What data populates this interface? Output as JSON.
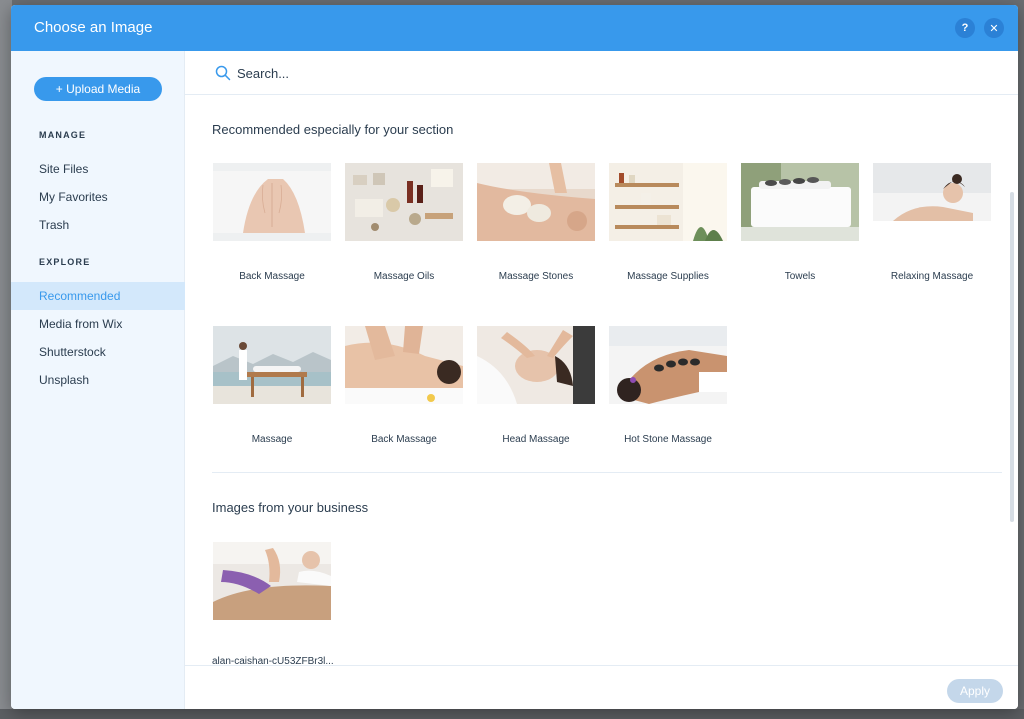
{
  "modal": {
    "title": "Choose an Image",
    "help_label": "?",
    "close_label": "✕"
  },
  "sidebar": {
    "upload_label": "+ Upload Media",
    "manage_label": "MANAGE",
    "manage_items": [
      "Site Files",
      "My Favorites",
      "Trash"
    ],
    "explore_label": "EXPLORE",
    "explore_items": [
      "Recommended",
      "Media from Wix",
      "Shutterstock",
      "Unsplash"
    ],
    "active_item": "Recommended"
  },
  "search": {
    "placeholder": "Search..."
  },
  "recommended": {
    "title": "Recommended especially for your section",
    "items": [
      {
        "caption": "Back Massage",
        "icon": "back-massage-photo"
      },
      {
        "caption": "Massage Oils",
        "icon": "massage-oils-photo"
      },
      {
        "caption": "Massage Stones",
        "icon": "massage-stones-photo"
      },
      {
        "caption": "Massage Supplies",
        "icon": "massage-supplies-photo"
      },
      {
        "caption": "Towels",
        "icon": "towels-photo"
      },
      {
        "caption": "Relaxing Massage",
        "icon": "relaxing-massage-photo"
      },
      {
        "caption": "Massage",
        "icon": "massage-photo"
      },
      {
        "caption": "Back Massage",
        "icon": "back-massage-photo"
      },
      {
        "caption": "Head Massage",
        "icon": "head-massage-photo"
      },
      {
        "caption": "Hot Stone Massage",
        "icon": "hot-stone-massage-photo"
      }
    ]
  },
  "business": {
    "title": "Images from your business",
    "items": [
      {
        "caption": "alan-caishan-cU53ZFBr3l...",
        "icon": "business-photo"
      }
    ]
  },
  "footer": {
    "apply_label": "Apply"
  },
  "colors": {
    "accent": "#3899ec",
    "sidebar_bg": "#f0f7fe",
    "active_bg": "#d3e8fb",
    "text": "#2b3d4f"
  }
}
